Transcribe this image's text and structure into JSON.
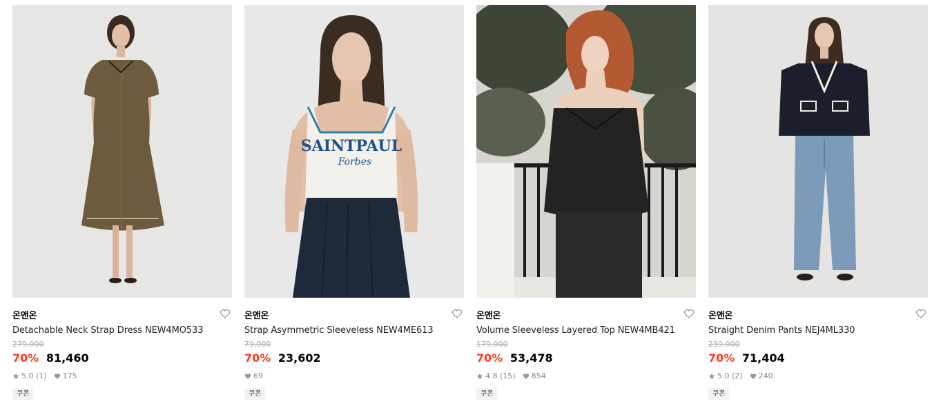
{
  "products": [
    {
      "brand": "온앤온",
      "name": "Detachable Neck Strap Dress NEW4MO533",
      "original_price": "279,000",
      "discount": "70%",
      "price": "81,460",
      "rating": "5.0 (1)",
      "likes": "175",
      "coupon": "쿠폰"
    },
    {
      "brand": "온앤온",
      "name": "Strap Asymmetric Sleeveless NEW4ME613",
      "original_price": "79,000",
      "discount": "70%",
      "price": "23,602",
      "likes": "69",
      "coupon": "쿠폰",
      "print_text": [
        "SAINTPAUL",
        "Forbes"
      ]
    },
    {
      "brand": "온앤온",
      "name": "Volume Sleeveless Layered Top NEW4MB421",
      "original_price": "179,000",
      "discount": "70%",
      "price": "53,478",
      "rating": "4.8 (15)",
      "likes": "854",
      "coupon": "쿠폰"
    },
    {
      "brand": "온앤온",
      "name": "Straight Denim Pants NEJ4ML330",
      "original_price": "239,000",
      "discount": "70%",
      "price": "71,404",
      "rating": "5.0 (2)",
      "likes": "240",
      "coupon": "쿠폰"
    }
  ],
  "icons": {
    "wishlist": "heart-outline-icon",
    "rating": "star-icon",
    "likes": "heart-filled-icon"
  },
  "colors": {
    "discount": "#ff3c1f",
    "muted": "#888888",
    "strikethrough": "#aaaaaa",
    "coupon_bg": "#f3f3f3"
  }
}
